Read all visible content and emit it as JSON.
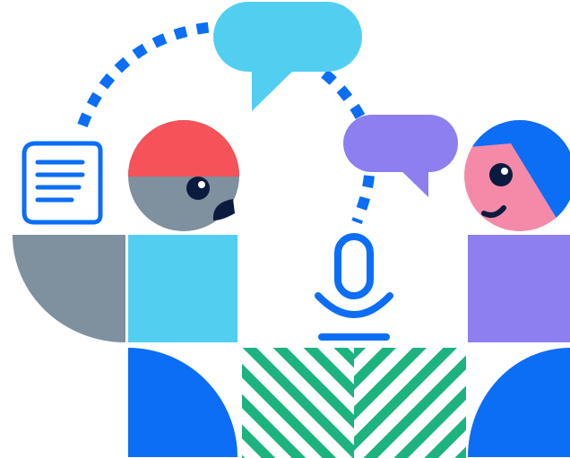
{
  "illustration": {
    "subject": "podcast-conversation",
    "icons": [
      "document-icon",
      "microphone-icon",
      "speech-bubble-icon"
    ],
    "colors": {
      "blue": "#0b6ef5",
      "dark_navy": "#0b1b3f",
      "cyan": "#52cff0",
      "purple": "#8d7ff0",
      "red": "#f5525a",
      "pink": "#f48aa8",
      "gray": "#7f909e",
      "green": "#1db37e",
      "white": "#ffffff"
    }
  }
}
